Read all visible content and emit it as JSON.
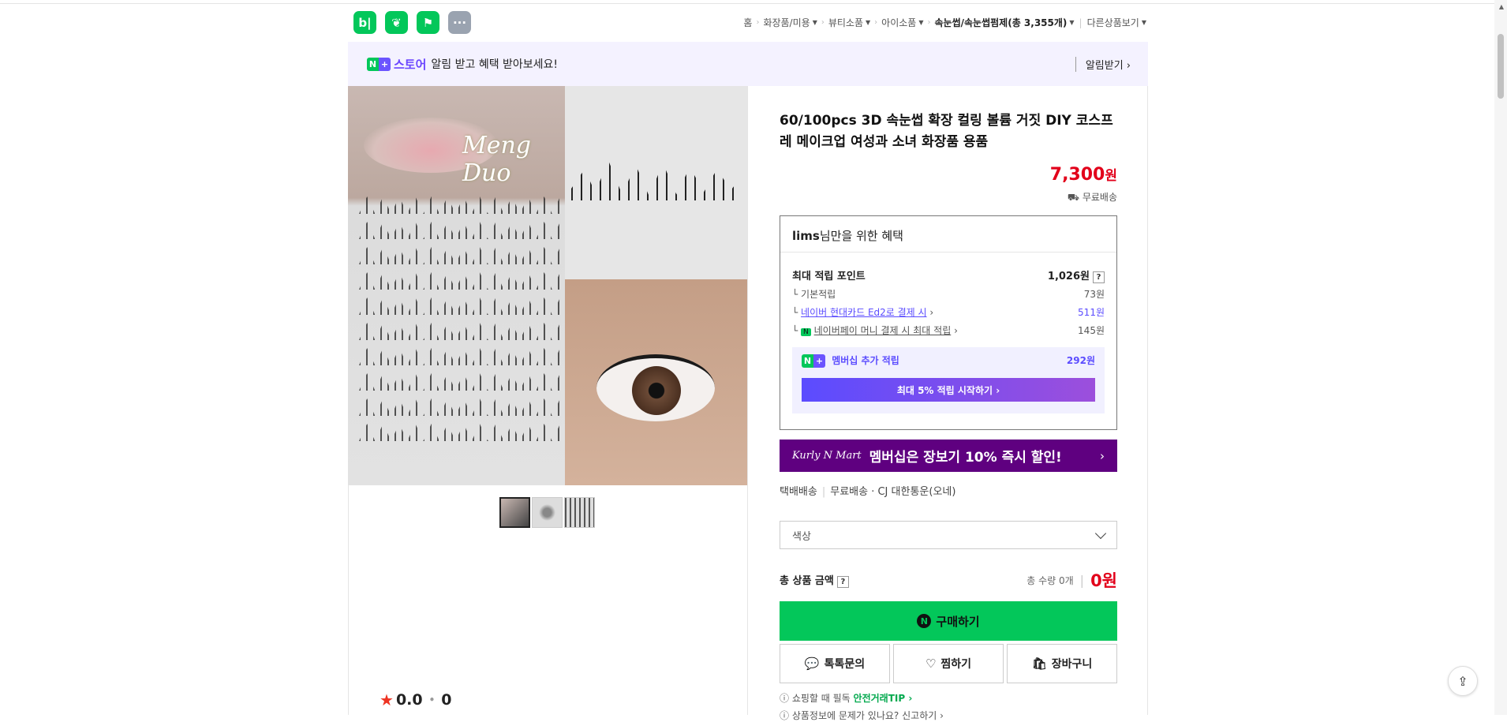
{
  "apps": [
    {
      "name": "blog-app-icon",
      "glyph": "b|"
    },
    {
      "name": "cafe-app-icon",
      "glyph": "❦"
    },
    {
      "name": "bookmark-app-icon",
      "glyph": "⚑"
    },
    {
      "name": "more-app-icon",
      "glyph": "···"
    }
  ],
  "breadcrumb": {
    "home": "홈",
    "c1": "화장품/미용",
    "c2": "뷰티소품",
    "c3": "아이소품",
    "c4": "속눈썹/속눈썹펌제(총 3,355개)",
    "other": "다른상품보기"
  },
  "notice": {
    "n": "N",
    "plus": "+",
    "store": "스토어",
    "text": "알림 받고 혜택 받아보세요!",
    "subscribe": "알림받기 ›"
  },
  "gallery": {
    "brand_text": "Meng Duo"
  },
  "rating": {
    "score": "0.0",
    "count": "0"
  },
  "product": {
    "title": "60/100pcs 3D 속눈썹 확장 컬링 볼륨 거짓 DIY 코스프레 메이크업 여성과 소녀 화장품 용품",
    "price": "7,300",
    "price_unit": "원",
    "shipping": "무료배송"
  },
  "benefit": {
    "user": "lims",
    "heading_suffix": "님만을 위한 혜택",
    "max_points_label": "최대 적립 포인트",
    "max_points_value": "1,026원",
    "q": "?",
    "rows": [
      {
        "label": "기본적립",
        "value": "73원"
      },
      {
        "label": "네이버 현대카드 Ed2로 결제 시",
        "value": "511원"
      },
      {
        "label": "네이버페이 머니 결제 시 최대 적립",
        "value": "145원"
      }
    ],
    "membership_label": "멤버십 추가 적립",
    "membership_value": "292원",
    "membership_button": "최대 5% 적립 시작하기 ›"
  },
  "kurly": {
    "brand": "Kurly N Mart",
    "text": "멤버십은 장보기 10% 즉시 할인!",
    "arrow": "›"
  },
  "delivery": {
    "type": "택배배송",
    "fee": "무료배송",
    "carrier": "CJ 대한통운(오네)"
  },
  "option": {
    "placeholder": "색상"
  },
  "total": {
    "label": "총 상품 금액",
    "qty": "총 수량 0개",
    "amount": "0원"
  },
  "actions": {
    "buy": "구매하기",
    "talk": "톡톡문의",
    "wish": "찜하기",
    "cart": "장바구니"
  },
  "tips": {
    "t1": "쇼핑할 때 필독",
    "t1_link": "안전거래TIP ›",
    "t2": "상품정보에 문제가 있나요?",
    "t2_link": "신고하기 ›"
  }
}
